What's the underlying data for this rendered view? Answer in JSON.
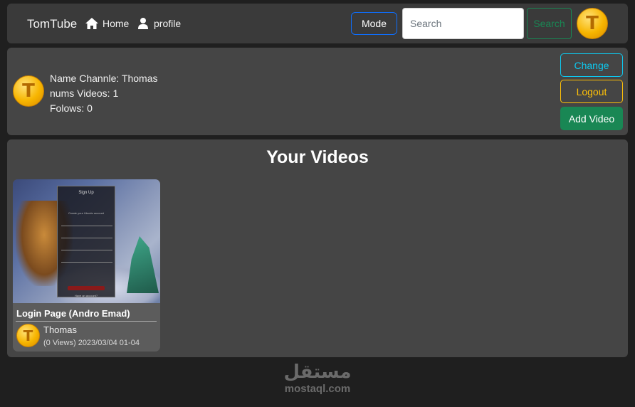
{
  "navbar": {
    "brand": "TomTube",
    "home_label": "Home",
    "profile_label": "profile",
    "mode_label": "Mode",
    "search_placeholder": "Search",
    "search_button_label": "Search",
    "avatar_letter": "T"
  },
  "channel": {
    "avatar_letter": "T",
    "name_line": "Name Channle: Thomas",
    "videos_line": "nums Videos: 1",
    "follows_line": "Folows: 0",
    "change_label": "Change",
    "logout_label": "Logout",
    "add_video_label": "Add Video"
  },
  "videos_section": {
    "title": "Your Videos",
    "items": [
      {
        "title": "Login Page (Andro Emad)",
        "channel": "Thomas",
        "meta": "(0 Views) 2023/03/04 01-04",
        "avatar_letter": "T",
        "thumbnail": {
          "form_title": "Sign Up",
          "form_subtitle": "Create your Ubuntu account",
          "form_link": "Have an account?"
        }
      }
    ]
  },
  "watermark": {
    "logo": "مستقل",
    "text": "mostaql.com"
  },
  "colors": {
    "page_bg": "#1f1f1f",
    "panel_bg": "#454545",
    "navbar_bg": "#3a3a3a",
    "primary": "#0d6efd",
    "success": "#198754",
    "info": "#0dcaf0",
    "warning": "#ffc107"
  },
  "icons": {
    "home": "house-icon",
    "profile": "person-icon"
  }
}
